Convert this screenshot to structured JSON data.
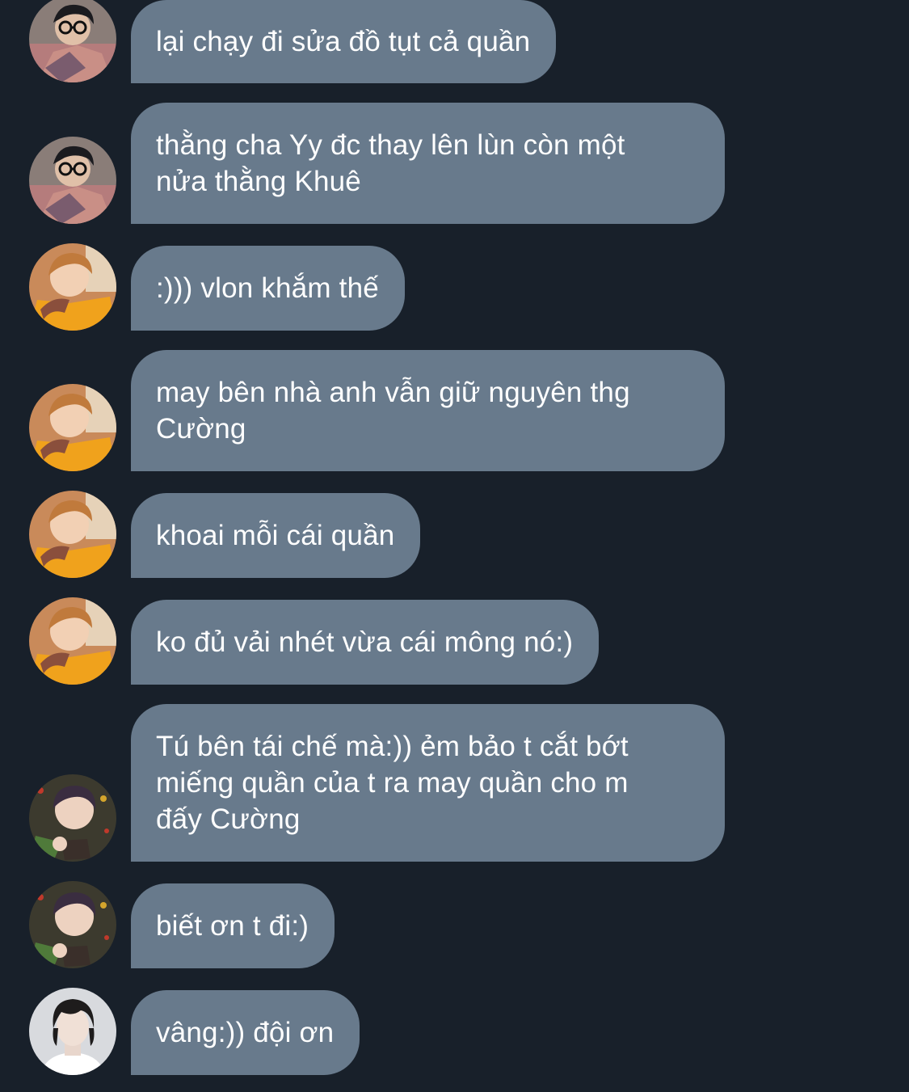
{
  "colors": {
    "background": "#18202a",
    "bubble": "#687a8c",
    "text": "#ffffff"
  },
  "messages": [
    {
      "avatar": "avatar-glasses-boy-icon",
      "text": "lại chạy đi sửa đồ tụt cả quần"
    },
    {
      "avatar": "avatar-glasses-boy-icon",
      "text": "thằng cha Yy đc thay lên lùn còn một\nnửa thằng Khuê"
    },
    {
      "avatar": "avatar-orange-sweater-icon",
      "text": ":))) vlon khắm thế"
    },
    {
      "avatar": "avatar-orange-sweater-icon",
      "text": "may bên nhà anh vẫn giữ nguyên thg\nCường"
    },
    {
      "avatar": "avatar-orange-sweater-icon",
      "text": "khoai mỗi cái quần"
    },
    {
      "avatar": "avatar-orange-sweater-icon",
      "text": "ko đủ vải nhét vừa cái mông nó:)"
    },
    {
      "avatar": "avatar-christmas-boy-icon",
      "text": "Tú bên tái chế mà:)) ẻm bảo t cắt bớt\nmiếng quần của t ra may quần cho m\nđấy Cường"
    },
    {
      "avatar": "avatar-christmas-boy-icon",
      "text": "biết ơn t đi:)"
    },
    {
      "avatar": "avatar-portrait-man-icon",
      "text": "vâng:)) đội ơn"
    }
  ]
}
